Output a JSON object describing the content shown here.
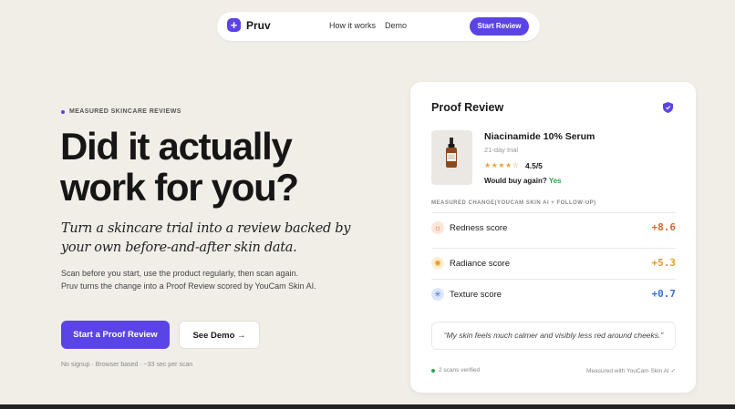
{
  "nav": {
    "brand": "Pruv",
    "links": [
      "How it works",
      "Demo"
    ],
    "cta": "Start Review"
  },
  "hero": {
    "eyebrow": "MEASURED SKINCARE REVIEWS",
    "headline": "Did it actually work for you?",
    "subhead": "Turn a skincare trial into a review backed by your own before-and-after skin data.",
    "body": "Scan before you start, use the product regularly, then scan again. Pruv turns the change into a Proof Review scored by YouCam Skin AI.",
    "primary_button": "Start a Proof Review",
    "secondary_button": "See Demo",
    "secondary_arrow": "→",
    "note": "No signup · Browser based · ~33 sec per scan"
  },
  "card": {
    "title": "Proof Review",
    "product_name": "Niacinamide 10% Serum",
    "trial": "21-day trial",
    "stars": "★★★★☆",
    "rating": "4.5/5",
    "buy_again_label": "Would buy again?",
    "buy_again_value": "Yes",
    "section_label": "MEASURED CHANGE(YOUCAM SKIN AI + FOLLOW-UP)",
    "metrics": [
      {
        "label": "Redness score",
        "value": "+8.6",
        "icon": "sun-icon",
        "color": "#e0662a"
      },
      {
        "label": "Radiance score",
        "value": "+5.3",
        "icon": "sparkle-icon",
        "color": "#e89a1c"
      },
      {
        "label": "Texture score",
        "value": "+0.7",
        "icon": "snowflake-icon",
        "color": "#3a6fd8"
      }
    ],
    "quote": "“My skin feels much calmer and visibly less red around cheeks.”",
    "verified": "2 scans verified",
    "measured": "Measured with YouCam Skin AI ✓"
  },
  "colors": {
    "accent": "#5b44e6",
    "background": "#f1eee8",
    "success": "#2aa84a"
  }
}
